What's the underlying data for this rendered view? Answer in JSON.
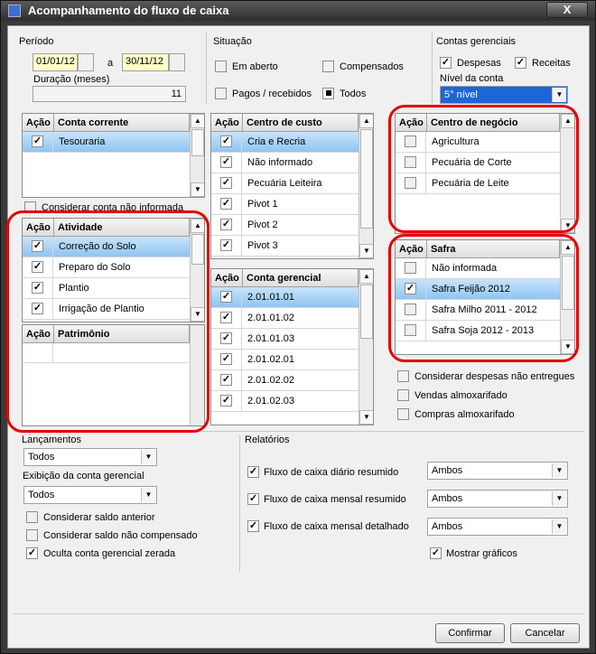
{
  "window": {
    "title": "Acompanhamento do fluxo de caixa",
    "close": "X"
  },
  "periodo": {
    "label": "Período",
    "start": "01/01/12",
    "sep": "a",
    "end": "30/11/12",
    "duracao_label": "Duração (meses)",
    "duracao": "11"
  },
  "situacao": {
    "label": "Situação",
    "em_aberto": "Em aberto",
    "compensados": "Compensados",
    "pagos": "Pagos / recebidos",
    "todos": "Todos"
  },
  "contas": {
    "label": "Contas gerenciais",
    "despesas": "Despesas",
    "receitas": "Receitas",
    "nivel_label": "Nível da conta",
    "nivel": "5° nível"
  },
  "conta_corrente": {
    "col_acao": "Ação",
    "col_name": "Conta corrente",
    "rows": [
      "Tesouraria"
    ]
  },
  "considerar_nao_informada": "Considerar conta não informada",
  "atividade": {
    "col_acao": "Ação",
    "col_name": "Atividade",
    "rows": [
      "Correção do Solo",
      "Preparo do Solo",
      "Plantio",
      "Irrigação de Plantio"
    ]
  },
  "patrimonio": {
    "col_acao": "Ação",
    "col_name": "Patrimônio"
  },
  "centro_custo": {
    "col_acao": "Ação",
    "col_name": "Centro de custo",
    "rows": [
      "Cria e Recria",
      "Não informado",
      "Pecuária Leiteira",
      "Pivot 1",
      "Pivot 2",
      "Pivot 3"
    ]
  },
  "conta_gerencial": {
    "col_acao": "Ação",
    "col_name": "Conta gerencial",
    "rows": [
      "2.01.01.01",
      "2.01.01.02",
      "2.01.01.03",
      "2.01.02.01",
      "2.01.02.02",
      "2.01.02.03"
    ]
  },
  "centro_negocio": {
    "col_acao": "Ação",
    "col_name": "Centro de negócio",
    "rows": [
      "Agricultura",
      "Pecuária de Corte",
      "Pecuária de Leite"
    ]
  },
  "safra": {
    "col_acao": "Ação",
    "col_name": "Safra",
    "rows": [
      "Não informada",
      "Safra Feijão 2012",
      "Safra Milho 2011 - 2012",
      "Safra Soja 2012 - 2013"
    ]
  },
  "opts_right": {
    "despesas_nao_entregues": "Considerar despesas não entregues",
    "vendas_almox": "Vendas almoxarifado",
    "compras_almox": "Compras almoxarifado"
  },
  "lancamentos": {
    "label": "Lançamentos",
    "value": "Todos",
    "exibicao_label": "Exibição da conta gerencial",
    "exibicao": "Todos",
    "saldo_anterior": "Considerar saldo anterior",
    "saldo_nao_comp": "Considerar saldo não compensado",
    "oculta_zerada": "Oculta conta gerencial zerada"
  },
  "relatorios": {
    "label": "Relatórios",
    "r1": "Fluxo de caixa diário resumido",
    "r2": "Fluxo de caixa mensal resumido",
    "r3": "Fluxo de caixa mensal detalhado",
    "v1": "Ambos",
    "v2": "Ambos",
    "v3": "Ambos",
    "graficos": "Mostrar gráficos"
  },
  "buttons": {
    "confirmar": "Confirmar",
    "cancelar": "Cancelar"
  },
  "colors": {
    "highlight": "#e60000",
    "selection": "#1d66d8"
  }
}
